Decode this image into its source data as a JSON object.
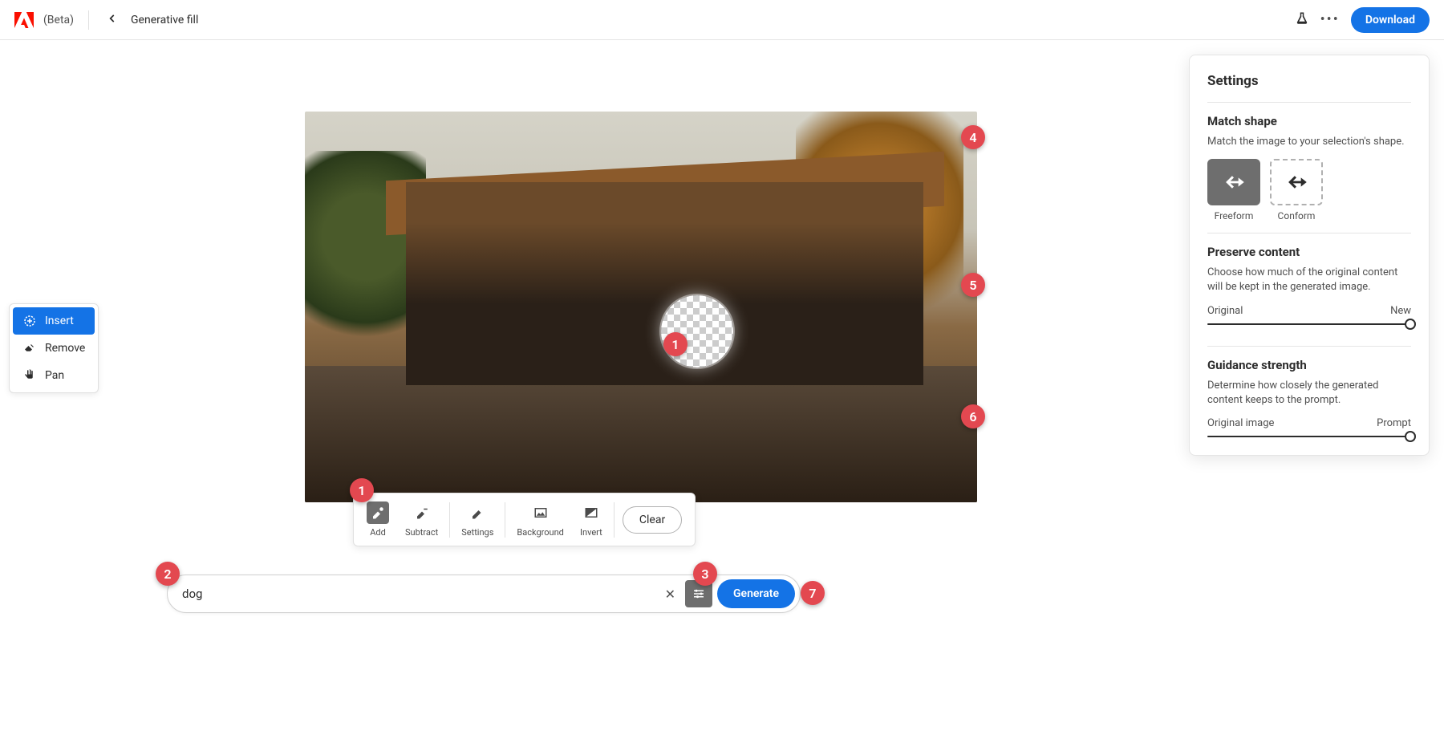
{
  "header": {
    "beta": "(Beta)",
    "title": "Generative fill",
    "download": "Download"
  },
  "left_tools": {
    "insert": "Insert",
    "remove": "Remove",
    "pan": "Pan"
  },
  "canvas_toolbar": {
    "add": "Add",
    "subtract": "Subtract",
    "settings": "Settings",
    "background": "Background",
    "invert": "Invert",
    "clear": "Clear"
  },
  "prompt": {
    "value": "dog",
    "generate": "Generate"
  },
  "settings": {
    "title": "Settings",
    "match_shape": {
      "title": "Match shape",
      "desc": "Match the image to your selection's shape.",
      "freeform": "Freeform",
      "conform": "Conform"
    },
    "preserve": {
      "title": "Preserve content",
      "desc": "Choose how much of the original content will be kept in the generated image.",
      "left": "Original",
      "right": "New"
    },
    "guidance": {
      "title": "Guidance strength",
      "desc": "Determine how closely the generated content keeps to the prompt.",
      "left": "Original image",
      "right": "Prompt"
    }
  },
  "badges": {
    "b1a": "1",
    "b1b": "1",
    "b2": "2",
    "b3": "3",
    "b4": "4",
    "b5": "5",
    "b6": "6",
    "b7": "7"
  }
}
